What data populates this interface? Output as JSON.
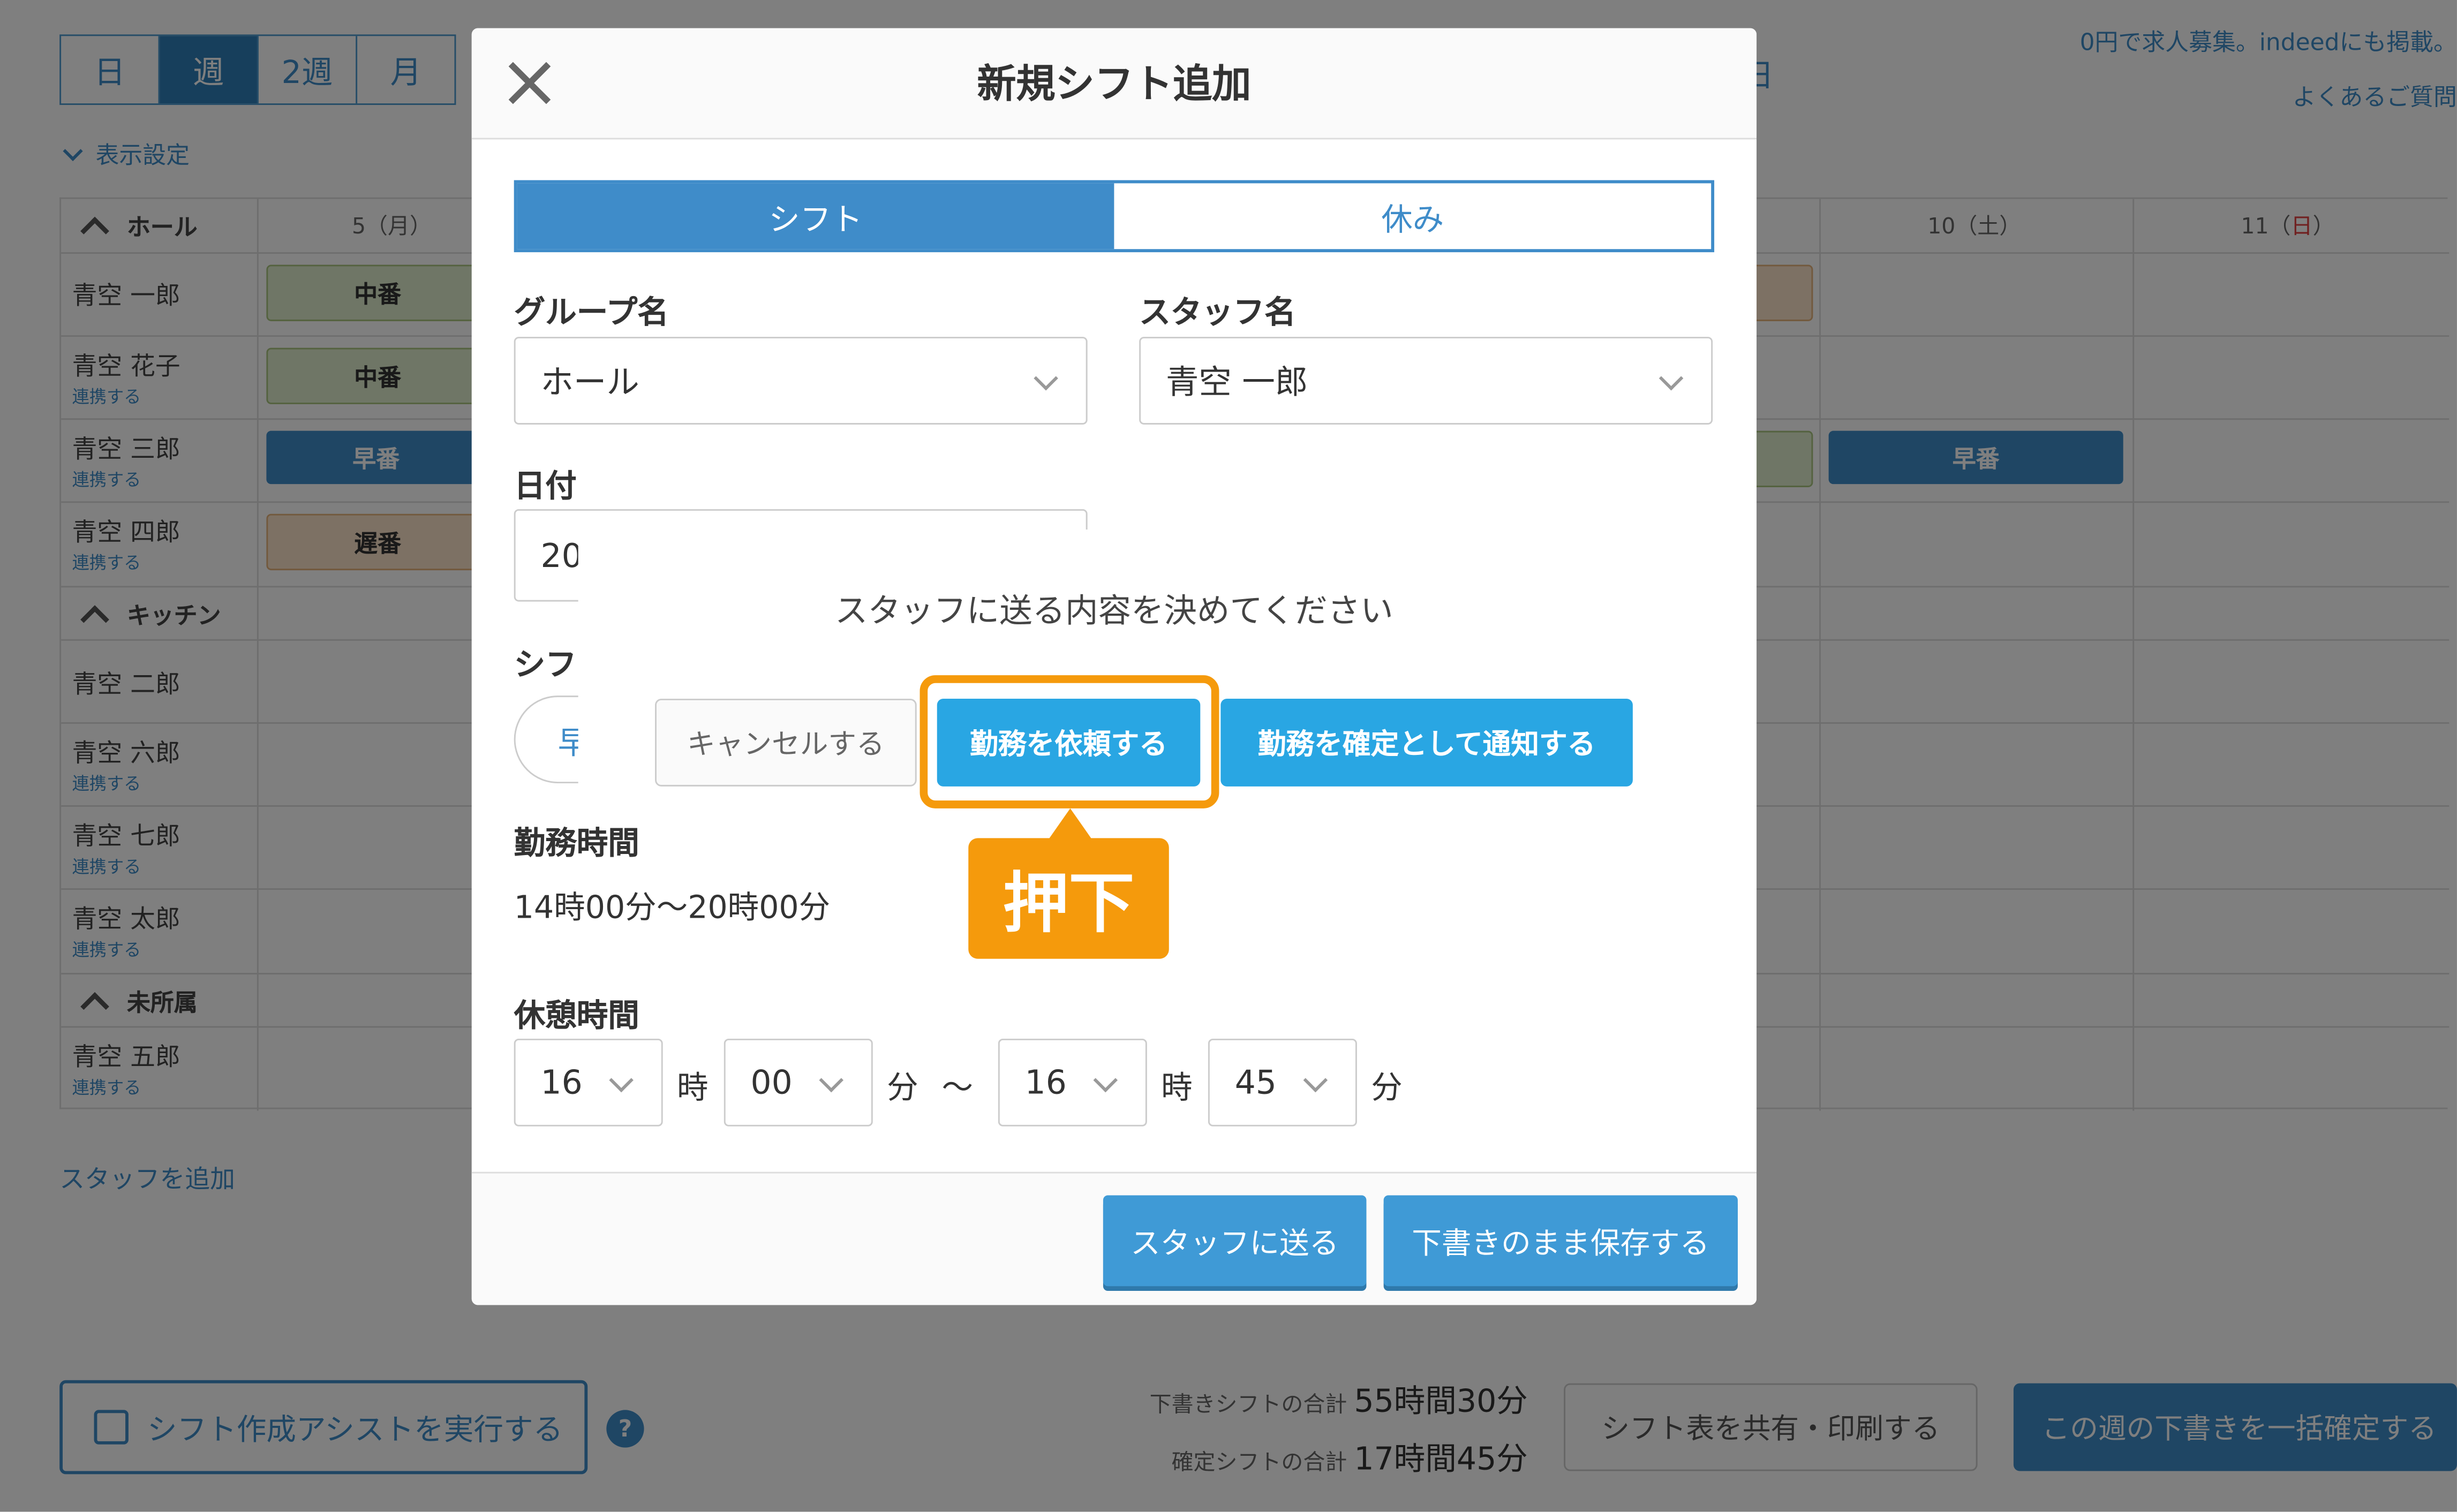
{
  "page": {
    "view_tabs": [
      "日",
      "週",
      "2週",
      "月"
    ],
    "active_view": "週",
    "display_settings": "表示設定",
    "promo_line1": "0円で求人募集。indeedにも掲載。",
    "promo_line2": "よくあるご質問",
    "calendar_date_partial": "日",
    "day_headers": {
      "mon": "5（月）",
      "sat": "10（土）",
      "sun_num": "11（",
      "sun_day": "日",
      "sun_close": "）"
    },
    "groups": [
      {
        "name": "ホール",
        "staff": [
          {
            "name": "青空 一郎",
            "sub": ""
          },
          {
            "name": "青空 花子",
            "sub": "連携する"
          },
          {
            "name": "青空 三郎",
            "sub": "連携する"
          },
          {
            "name": "青空 四郎",
            "sub": "連携する"
          }
        ]
      },
      {
        "name": "キッチン",
        "staff": [
          {
            "name": "青空 二郎",
            "sub": ""
          },
          {
            "name": "青空 六郎",
            "sub": "連携する"
          },
          {
            "name": "青空 七郎",
            "sub": "連携する"
          },
          {
            "name": "青空 太郎",
            "sub": "連携する"
          }
        ]
      },
      {
        "name": "未所属",
        "staff": [
          {
            "name": "青空 五郎",
            "sub": "連携する"
          }
        ]
      }
    ],
    "shift_pills": {
      "mid": "中番",
      "early": "早番",
      "late": "遅番"
    },
    "add_staff": "スタッフを追加",
    "assist_button": "シフト作成アシストを実行する",
    "help_icon": "?",
    "draft_total_label": "下書きシフトの合計",
    "draft_total_value": "55時間30分",
    "confirmed_total_label": "確定シフトの合計",
    "confirmed_total_value": "17時間45分",
    "share_print_button": "シフト表を共有・印刷する",
    "bulk_confirm_button": "この週の下書きを一括確定する"
  },
  "modal": {
    "title": "新規シフト追加",
    "tabs": [
      "シフト",
      "休み"
    ],
    "active_tab": "シフト",
    "group_label": "グループ名",
    "group_value": "ホール",
    "staff_label": "スタッフ名",
    "staff_value": "青空 一郎",
    "date_label": "日付",
    "date_value_partial": "20",
    "shift_label_partial": "シフ",
    "shift_chip_partial": "早",
    "work_time_label": "勤務時間",
    "work_time_value": "14時00分〜20時00分",
    "break_label": "休憩時間",
    "break_start_hour": "16",
    "break_start_min": "00",
    "break_end_hour": "16",
    "break_end_min": "45",
    "unit_hour": "時",
    "unit_min": "分",
    "tilde": "〜",
    "send_button": "スタッフに送る",
    "save_draft_button": "下書きのまま保存する"
  },
  "dialog": {
    "message": "スタッフに送る内容を決めてください",
    "cancel_button": "キャンセルする",
    "request_button": "勤務を依頼する",
    "confirm_notify_button": "勤務を確定として通知する"
  },
  "annotation": {
    "callout": "押下",
    "color": "#f59a0c"
  }
}
